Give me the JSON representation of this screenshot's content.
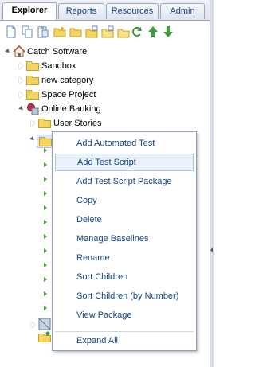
{
  "tabs": [
    {
      "label": "Explorer",
      "active": true
    },
    {
      "label": "Reports",
      "active": false
    },
    {
      "label": "Resources",
      "active": false
    },
    {
      "label": "Admin",
      "active": false
    }
  ],
  "toolbar": {
    "icons": [
      "new-document-icon",
      "copy-icon",
      "paste-icon",
      "new-folder-icon",
      "folder-open-icon",
      "folder-move-icon",
      "folder-copy-icon",
      "refresh-icon",
      "move-up-icon",
      "move-down-icon"
    ]
  },
  "tree": {
    "root": "Catch Software",
    "items": [
      "Sandbox",
      "new category",
      "Space Project",
      "Online Banking"
    ],
    "sub_items": [
      "User Stories"
    ]
  },
  "context_menu": {
    "items": [
      "Add Automated Test",
      "Add Test Script",
      "Add Test Script Package",
      "Copy",
      "Delete",
      "Manage Baselines",
      "Rename",
      "Sort Children",
      "Sort Children (by Number)",
      "View Package",
      "Expand All"
    ],
    "highlighted": "Add Test Script"
  },
  "colors": {
    "menu_text": "#15428b",
    "folder_yellow": "#f4d35e",
    "tree_triangle_green": "#4a9a3a",
    "hover_bg": "#eaf2fc"
  }
}
